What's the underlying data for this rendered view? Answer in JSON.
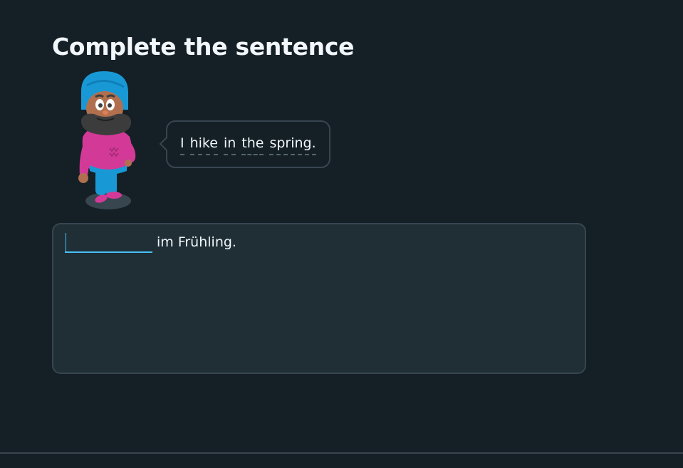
{
  "challenge": {
    "title": "Complete the sentence"
  },
  "prompt": {
    "words": [
      "I",
      "hike",
      "in",
      "the",
      "spring."
    ]
  },
  "answer": {
    "blank_value": "",
    "suffix_text": "im Frühling."
  },
  "colors": {
    "background": "#151f26",
    "panel": "#202f36",
    "border": "#37464f",
    "accent": "#49c0f8",
    "text": "#f1f7fb"
  },
  "icons": {
    "character": "character-icon"
  }
}
